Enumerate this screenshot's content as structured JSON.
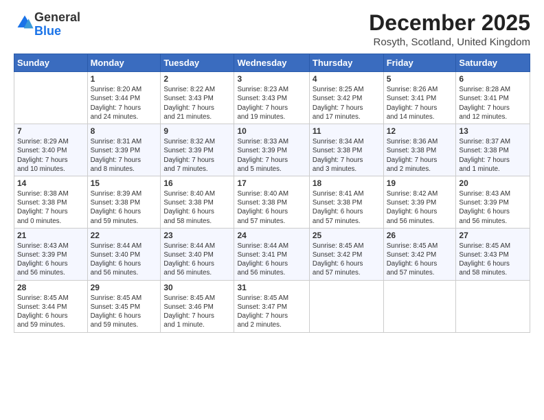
{
  "logo": {
    "general": "General",
    "blue": "Blue"
  },
  "header": {
    "title": "December 2025",
    "location": "Rosyth, Scotland, United Kingdom"
  },
  "weekdays": [
    "Sunday",
    "Monday",
    "Tuesday",
    "Wednesday",
    "Thursday",
    "Friday",
    "Saturday"
  ],
  "weeks": [
    [
      {
        "day": "",
        "info": ""
      },
      {
        "day": "1",
        "info": "Sunrise: 8:20 AM\nSunset: 3:44 PM\nDaylight: 7 hours\nand 24 minutes."
      },
      {
        "day": "2",
        "info": "Sunrise: 8:22 AM\nSunset: 3:43 PM\nDaylight: 7 hours\nand 21 minutes."
      },
      {
        "day": "3",
        "info": "Sunrise: 8:23 AM\nSunset: 3:43 PM\nDaylight: 7 hours\nand 19 minutes."
      },
      {
        "day": "4",
        "info": "Sunrise: 8:25 AM\nSunset: 3:42 PM\nDaylight: 7 hours\nand 17 minutes."
      },
      {
        "day": "5",
        "info": "Sunrise: 8:26 AM\nSunset: 3:41 PM\nDaylight: 7 hours\nand 14 minutes."
      },
      {
        "day": "6",
        "info": "Sunrise: 8:28 AM\nSunset: 3:41 PM\nDaylight: 7 hours\nand 12 minutes."
      }
    ],
    [
      {
        "day": "7",
        "info": "Sunrise: 8:29 AM\nSunset: 3:40 PM\nDaylight: 7 hours\nand 10 minutes."
      },
      {
        "day": "8",
        "info": "Sunrise: 8:31 AM\nSunset: 3:39 PM\nDaylight: 7 hours\nand 8 minutes."
      },
      {
        "day": "9",
        "info": "Sunrise: 8:32 AM\nSunset: 3:39 PM\nDaylight: 7 hours\nand 7 minutes."
      },
      {
        "day": "10",
        "info": "Sunrise: 8:33 AM\nSunset: 3:39 PM\nDaylight: 7 hours\nand 5 minutes."
      },
      {
        "day": "11",
        "info": "Sunrise: 8:34 AM\nSunset: 3:38 PM\nDaylight: 7 hours\nand 3 minutes."
      },
      {
        "day": "12",
        "info": "Sunrise: 8:36 AM\nSunset: 3:38 PM\nDaylight: 7 hours\nand 2 minutes."
      },
      {
        "day": "13",
        "info": "Sunrise: 8:37 AM\nSunset: 3:38 PM\nDaylight: 7 hours\nand 1 minute."
      }
    ],
    [
      {
        "day": "14",
        "info": "Sunrise: 8:38 AM\nSunset: 3:38 PM\nDaylight: 7 hours\nand 0 minutes."
      },
      {
        "day": "15",
        "info": "Sunrise: 8:39 AM\nSunset: 3:38 PM\nDaylight: 6 hours\nand 59 minutes."
      },
      {
        "day": "16",
        "info": "Sunrise: 8:40 AM\nSunset: 3:38 PM\nDaylight: 6 hours\nand 58 minutes."
      },
      {
        "day": "17",
        "info": "Sunrise: 8:40 AM\nSunset: 3:38 PM\nDaylight: 6 hours\nand 57 minutes."
      },
      {
        "day": "18",
        "info": "Sunrise: 8:41 AM\nSunset: 3:38 PM\nDaylight: 6 hours\nand 57 minutes."
      },
      {
        "day": "19",
        "info": "Sunrise: 8:42 AM\nSunset: 3:39 PM\nDaylight: 6 hours\nand 56 minutes."
      },
      {
        "day": "20",
        "info": "Sunrise: 8:43 AM\nSunset: 3:39 PM\nDaylight: 6 hours\nand 56 minutes."
      }
    ],
    [
      {
        "day": "21",
        "info": "Sunrise: 8:43 AM\nSunset: 3:39 PM\nDaylight: 6 hours\nand 56 minutes."
      },
      {
        "day": "22",
        "info": "Sunrise: 8:44 AM\nSunset: 3:40 PM\nDaylight: 6 hours\nand 56 minutes."
      },
      {
        "day": "23",
        "info": "Sunrise: 8:44 AM\nSunset: 3:40 PM\nDaylight: 6 hours\nand 56 minutes."
      },
      {
        "day": "24",
        "info": "Sunrise: 8:44 AM\nSunset: 3:41 PM\nDaylight: 6 hours\nand 56 minutes."
      },
      {
        "day": "25",
        "info": "Sunrise: 8:45 AM\nSunset: 3:42 PM\nDaylight: 6 hours\nand 57 minutes."
      },
      {
        "day": "26",
        "info": "Sunrise: 8:45 AM\nSunset: 3:42 PM\nDaylight: 6 hours\nand 57 minutes."
      },
      {
        "day": "27",
        "info": "Sunrise: 8:45 AM\nSunset: 3:43 PM\nDaylight: 6 hours\nand 58 minutes."
      }
    ],
    [
      {
        "day": "28",
        "info": "Sunrise: 8:45 AM\nSunset: 3:44 PM\nDaylight: 6 hours\nand 59 minutes."
      },
      {
        "day": "29",
        "info": "Sunrise: 8:45 AM\nSunset: 3:45 PM\nDaylight: 6 hours\nand 59 minutes."
      },
      {
        "day": "30",
        "info": "Sunrise: 8:45 AM\nSunset: 3:46 PM\nDaylight: 7 hours\nand 1 minute."
      },
      {
        "day": "31",
        "info": "Sunrise: 8:45 AM\nSunset: 3:47 PM\nDaylight: 7 hours\nand 2 minutes."
      },
      {
        "day": "",
        "info": ""
      },
      {
        "day": "",
        "info": ""
      },
      {
        "day": "",
        "info": ""
      }
    ]
  ]
}
